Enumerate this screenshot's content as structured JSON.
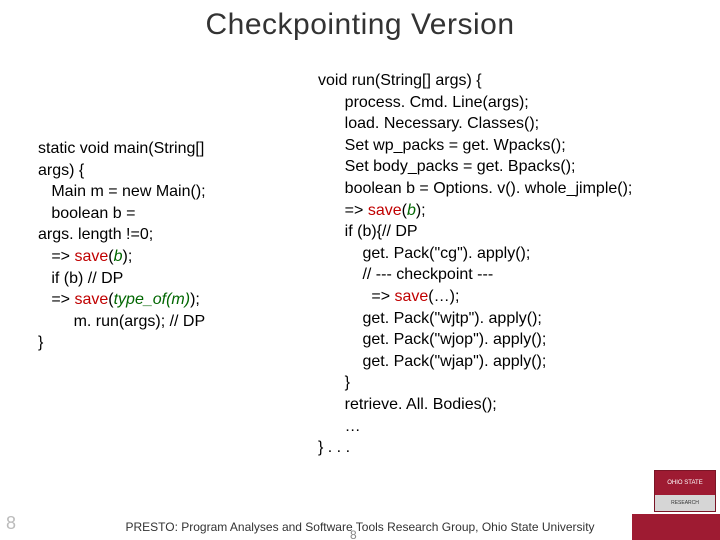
{
  "title": "Checkpointing Version",
  "left": {
    "l1": "static void main(String[]",
    "l2": "args) {",
    "l3": "   Main m = new Main();",
    "l4": "   boolean b =",
    "l5": "args. length !=0;",
    "l6a": "   => ",
    "l6b": "save",
    "l6c": "(",
    "l6d": "b",
    "l6e": ");",
    "l7": "   if (b) // DP",
    "l8a": "   => ",
    "l8b": "save",
    "l8c": "(",
    "l8d": "type_of(m)",
    "l8e": ");",
    "l9": "        m. run(args); // DP",
    "l10": "}"
  },
  "right": {
    "r1": "void run(String[] args) {",
    "r2": "      process. Cmd. Line(args);",
    "r3": "      load. Necessary. Classes();",
    "r4": "      Set wp_packs = get. Wpacks();",
    "r5": "      Set body_packs = get. Bpacks();",
    "r6": "      boolean b = Options. v(). whole_jimple();",
    "r7a": "      => ",
    "r7b": "save",
    "r7c": "(",
    "r7d": "b",
    "r7e": ");",
    "r8": "      if (b){// DP",
    "r9": "          get. Pack(\"cg\"). apply();",
    "r10": "          // --- checkpoint ---",
    "r11a": "            => ",
    "r11b": "save",
    "r11c": "(…);",
    "r12": "          get. Pack(\"wjtp\"). apply();",
    "r13": "          get. Pack(\"wjop\"). apply();",
    "r14": "          get. Pack(\"wjap\"). apply();",
    "r15": "      }",
    "r16": "      retrieve. All. Bodies();",
    "r17": "      …",
    "r18": "} . . ."
  },
  "footer": "PRESTO: Program Analyses and Software Tools Research Group, Ohio State University",
  "page_num": "8",
  "page_num_small": "8",
  "logo_top": "OHIO STATE",
  "logo_bottom": "RESEARCH"
}
